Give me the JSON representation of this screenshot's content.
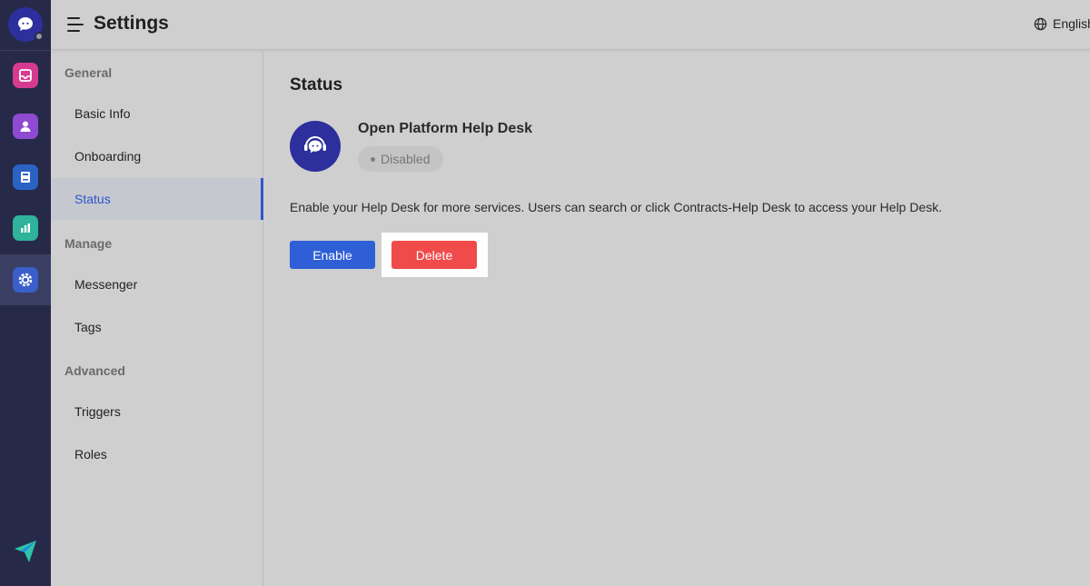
{
  "header": {
    "title": "Settings",
    "language": "English"
  },
  "rail": {
    "items": [
      {
        "name": "inbox",
        "icon": "inbox-icon",
        "color": "#d63b8f"
      },
      {
        "name": "contacts",
        "icon": "contact-icon",
        "color": "#8e4ad1"
      },
      {
        "name": "knowledge",
        "icon": "book-icon",
        "color": "#2a63c4"
      },
      {
        "name": "reports",
        "icon": "chart-icon",
        "color": "#2fb39a"
      },
      {
        "name": "settings",
        "icon": "gear-icon",
        "color": "#3b5fc9"
      }
    ],
    "bottom_icon": "send-icon"
  },
  "settings_nav": {
    "groups": [
      {
        "label": "General",
        "items": [
          "Basic Info",
          "Onboarding",
          "Status"
        ]
      },
      {
        "label": "Manage",
        "items": [
          "Messenger",
          "Tags"
        ]
      },
      {
        "label": "Advanced",
        "items": [
          "Triggers",
          "Roles"
        ]
      }
    ],
    "active_item": "Status"
  },
  "main": {
    "section_title": "Status",
    "desk_name": "Open Platform Help Desk",
    "status_badge": "Disabled",
    "description": "Enable your Help Desk for more services. Users can search or click Contracts-Help Desk to access your Help Desk.",
    "enable_label": "Enable",
    "delete_label": "Delete"
  },
  "colors": {
    "accent": "#2f5fd6",
    "danger": "#f04a4a",
    "rail_bg": "#262a48",
    "brand": "#2c2f9c"
  }
}
